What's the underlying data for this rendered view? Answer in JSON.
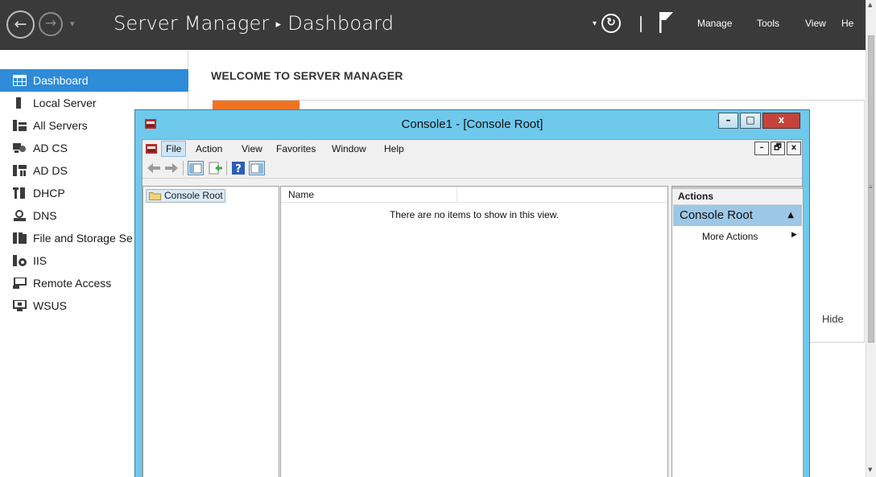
{
  "header": {
    "back_glyph": "←",
    "forward_glyph": "→",
    "dropdown_glyph": "▾",
    "breadcrumb": [
      "Server Manager",
      "Dashboard"
    ],
    "breadcrumb_sep": "▸",
    "refresh_dropdown_glyph": "▾",
    "refresh_glyph": "↻",
    "menu": {
      "manage": "Manage",
      "tools": "Tools",
      "view": "View",
      "help": "He"
    }
  },
  "sidebar": {
    "items": [
      {
        "label": "Dashboard",
        "icon": "dashboard-grid-icon",
        "active": true
      },
      {
        "label": "Local Server",
        "icon": "server-icon"
      },
      {
        "label": "All Servers",
        "icon": "servers-icon"
      },
      {
        "label": "AD CS",
        "icon": "certificate-services-icon"
      },
      {
        "label": "AD DS",
        "icon": "directory-services-icon"
      },
      {
        "label": "DHCP",
        "icon": "dhcp-icon"
      },
      {
        "label": "DNS",
        "icon": "dns-icon"
      },
      {
        "label": "File and Storage Se",
        "icon": "storage-icon"
      },
      {
        "label": "IIS",
        "icon": "iis-icon"
      },
      {
        "label": "Remote Access",
        "icon": "remote-access-icon"
      },
      {
        "label": "WSUS",
        "icon": "wsus-icon"
      }
    ]
  },
  "main": {
    "welcome_title": "WELCOME TO SERVER MANAGER",
    "hide_label": "Hide"
  },
  "console": {
    "title": "Console1 - [Console Root]",
    "caption": {
      "minimize": "–",
      "maximize": "□",
      "close": "x"
    },
    "menu": {
      "file": "File",
      "action": "Action",
      "view": "View",
      "favorites": "Favorites",
      "window": "Window",
      "help": "Help"
    },
    "child_buttons": {
      "minimize": "–",
      "restore": "🗗",
      "close": "x"
    },
    "tree_root": "Console Root",
    "list": {
      "column_name": "Name",
      "empty_message": "There are no items to show in this view."
    },
    "actions": {
      "title": "Actions",
      "group": "Console Root",
      "group_arrow": "▲",
      "more_actions": "More Actions",
      "more_actions_arrow": "▶"
    }
  },
  "colors": {
    "header_bg": "#3a3a3a",
    "active_nav": "#2e8bd8",
    "accent_orange": "#f27221",
    "mmc_frame": "#6fc9ec",
    "close_button": "#c5433a",
    "actions_group_bg": "#9dc7e6"
  }
}
